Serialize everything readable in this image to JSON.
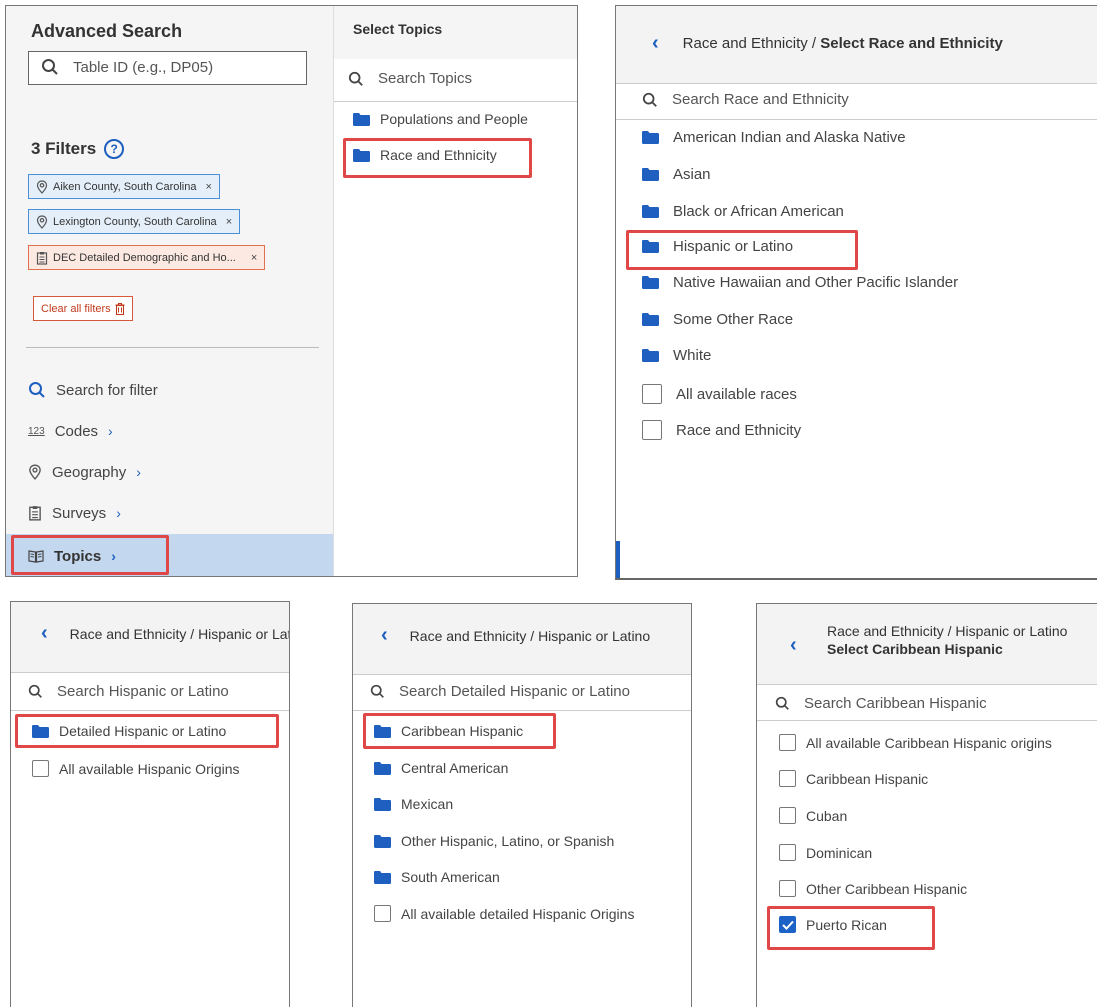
{
  "panel1": {
    "title": "Advanced Search",
    "table_id_placeholder": "Table ID (e.g., DP05)",
    "filters_heading": "3 Filters",
    "help_glyph": "?",
    "filters": [
      {
        "label": "Aiken County, South Carolina",
        "icon": "location-pin-icon",
        "remove": "×"
      },
      {
        "label": "Lexington County, South Carolina",
        "icon": "location-pin-icon",
        "remove": "×"
      },
      {
        "label": "DEC Detailed Demographic and Ho...",
        "icon": "clipboard-icon",
        "remove": "×"
      }
    ],
    "clear_all": "Clear all filters",
    "nav": [
      {
        "label": "Search for filter",
        "icon": "search-icon",
        "chevron": ""
      },
      {
        "label": "Codes",
        "icon": "codes-icon",
        "icon_text": "123",
        "chevron": "›"
      },
      {
        "label": "Geography",
        "icon": "location-pin-icon",
        "chevron": "›"
      },
      {
        "label": "Surveys",
        "icon": "clipboard-icon",
        "chevron": "›"
      },
      {
        "label": "Topics",
        "icon": "book-icon",
        "chevron": "›"
      }
    ],
    "select_topics": {
      "heading": "Select Topics",
      "search": "Search Topics",
      "items": [
        "Populations and People",
        "Race and Ethnicity"
      ]
    }
  },
  "panel2": {
    "back": "‹",
    "breadcrumb_prefix": "Race and Ethnicity / ",
    "breadcrumb_current": "Select Race and Ethnicity",
    "search": "Search Race and Ethnicity",
    "folders": [
      "American Indian and Alaska Native",
      "Asian",
      "Black or African American",
      "Hispanic or Latino",
      "Native Hawaiian and Other Pacific Islander",
      "Some Other Race",
      "White"
    ],
    "checkboxes": [
      "All available races",
      "Race and Ethnicity"
    ]
  },
  "panel3": {
    "back": "‹",
    "breadcrumb": "Race and Ethnicity / Hispanic or Latino",
    "search": "Search Hispanic or Latino",
    "folders": [
      "Detailed Hispanic or Latino"
    ],
    "checkboxes": [
      "All available Hispanic Origins"
    ]
  },
  "panel4": {
    "back": "‹",
    "breadcrumb": "Race and Ethnicity / Hispanic or Latino",
    "search": "Search Detailed Hispanic or Latino",
    "folders": [
      "Caribbean Hispanic",
      "Central American",
      "Mexican",
      "Other Hispanic, Latino, or Spanish",
      "South American"
    ],
    "checkboxes": [
      "All available detailed Hispanic Origins"
    ]
  },
  "panel5": {
    "back": "‹",
    "breadcrumb": "Race and Ethnicity / Hispanic or Latino",
    "subtitle": "Select Caribbean Hispanic",
    "search": "Search Caribbean Hispanic",
    "checkboxes": [
      {
        "label": "All available Caribbean Hispanic origins",
        "checked": false
      },
      {
        "label": "Caribbean Hispanic",
        "checked": false
      },
      {
        "label": "Cuban",
        "checked": false
      },
      {
        "label": "Dominican",
        "checked": false
      },
      {
        "label": "Other Caribbean Hispanic",
        "checked": false
      },
      {
        "label": "Puerto Rican",
        "checked": true
      }
    ]
  },
  "colors": {
    "accent": "#1d5fbf",
    "folder": "#1f5fbf",
    "highlight_box": "#e04848",
    "active_nav": "#c3d8ef",
    "chip_blue": "#e5eff9",
    "chip_orange": "#fce9e2"
  }
}
